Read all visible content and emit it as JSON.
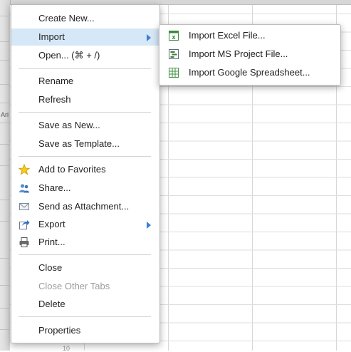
{
  "main_menu": {
    "items": [
      {
        "label": "Create New..."
      },
      {
        "label": "Import"
      },
      {
        "label": "Open... (⌘ + /)"
      },
      {
        "label": "Rename"
      },
      {
        "label": "Refresh"
      },
      {
        "label": "Save as New..."
      },
      {
        "label": "Save as Template..."
      },
      {
        "label": "Add to Favorites",
        "icon": "star-icon"
      },
      {
        "label": "Share...",
        "icon": "users-icon"
      },
      {
        "label": "Send as Attachment...",
        "icon": "envelope-icon"
      },
      {
        "label": "Export",
        "icon": "export-icon"
      },
      {
        "label": "Print...",
        "icon": "printer-icon"
      },
      {
        "label": "Close"
      },
      {
        "label": "Close Other Tabs",
        "disabled": true
      },
      {
        "label": "Delete"
      },
      {
        "label": "Properties"
      }
    ]
  },
  "import_submenu": {
    "items": [
      {
        "label": "Import Excel File...",
        "icon": "excel-file-icon"
      },
      {
        "label": "Import MS Project File...",
        "icon": "ms-project-file-icon"
      },
      {
        "label": "Import Google Spreadsheet...",
        "icon": "google-spreadsheet-icon"
      }
    ]
  },
  "background": {
    "toolbar_labels": [
      "Ari",
      "10"
    ]
  },
  "colors": {
    "active_highlight": "#d6e7f7",
    "submenu_arrow": "#3d7fcf",
    "disabled_text": "#9c9c9c"
  }
}
